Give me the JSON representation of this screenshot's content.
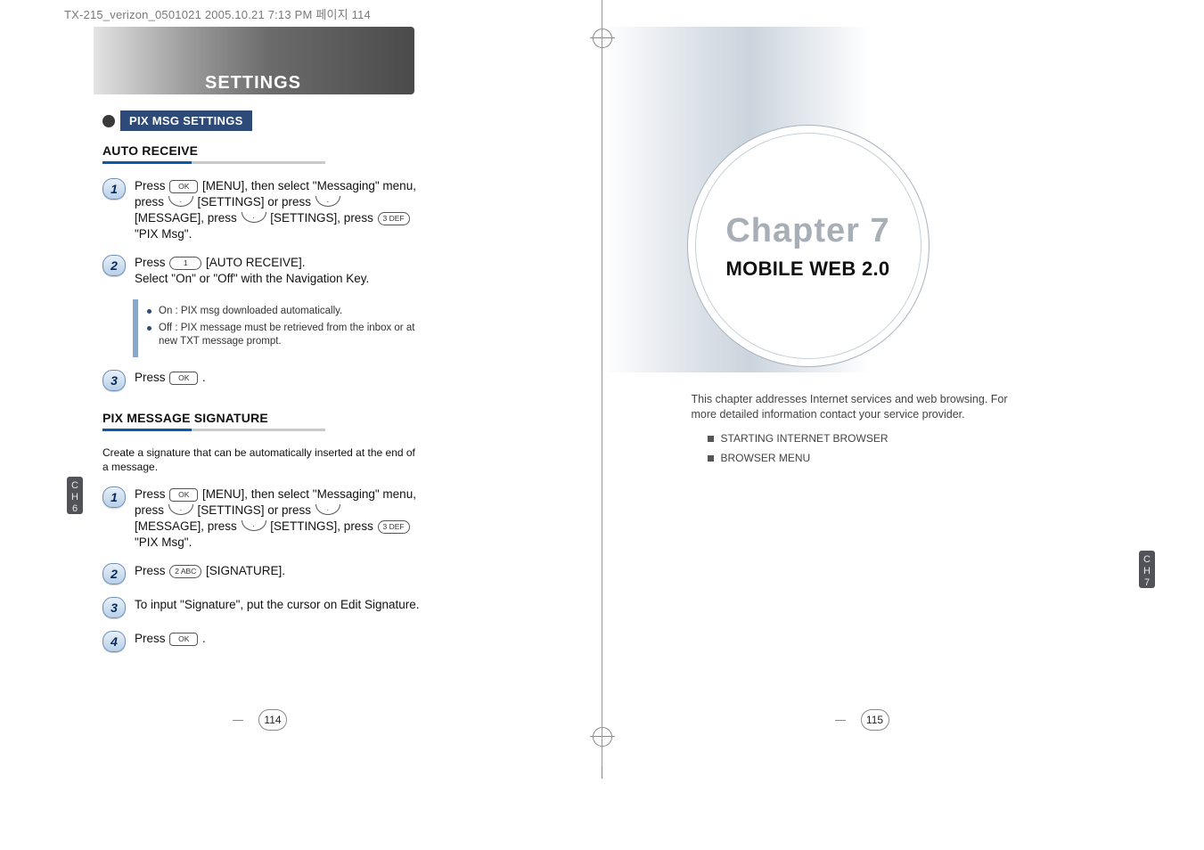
{
  "slug": "TX-215_verizon_0501021  2005.10.21  7:13 PM  페이지 114",
  "left_page": {
    "header_title": "SETTINGS",
    "section_label": "PIX MSG SETTINGS",
    "auto_receive": {
      "heading": "AUTO RECEIVE",
      "step1_a": "Press ",
      "step1_b": " [MENU], then select \"Messaging\" menu, press ",
      "step1_c": " [SETTINGS] or press ",
      "step1_d": " [MESSAGE], press ",
      "step1_e": " [SETTINGS], press ",
      "step1_f": " \"PIX Msg\".",
      "key_ok": "OK",
      "key_3": "3 DEF",
      "step2_a": "Press ",
      "step2_b": " [AUTO RECEIVE].",
      "step2_c": "Select \"On\" or \"Off\" with the Navigation Key.",
      "key_1": "1",
      "note_on": "On : PIX msg downloaded automatically.",
      "note_off": "Off : PIX message must be retrieved from the inbox or at new TXT message prompt.",
      "step3_a": "Press ",
      "step3_b": " ."
    },
    "signature": {
      "heading": "PIX MESSAGE SIGNATURE",
      "desc": "Create a signature that can be automatically inserted at the end of a message.",
      "step1_a": "Press ",
      "step1_b": " [MENU], then select \"Messaging\" menu, press ",
      "step1_c": " [SETTINGS] or press ",
      "step1_d": " [MESSAGE], press ",
      "step1_e": " [SETTINGS], press ",
      "step1_f": " \"PIX Msg\".",
      "step2_a": "Press ",
      "step2_b": " [SIGNATURE].",
      "key_2": "2 ABC",
      "step3": "To input \"Signature\", put the cursor on Edit Signature.",
      "step4_a": "Press ",
      "step4_b": " ."
    },
    "ch_tab": "C\nH\n6",
    "page_number": "114"
  },
  "right_page": {
    "chapter_label": "Chapter 7",
    "chapter_title": "MOBILE WEB 2.0",
    "desc": "This chapter addresses Internet services and web browsing. For more detailed information contact your service provider.",
    "list": [
      "STARTING INTERNET BROWSER",
      "BROWSER MENU"
    ],
    "ch_tab": "C\nH\n7",
    "page_number": "115"
  }
}
